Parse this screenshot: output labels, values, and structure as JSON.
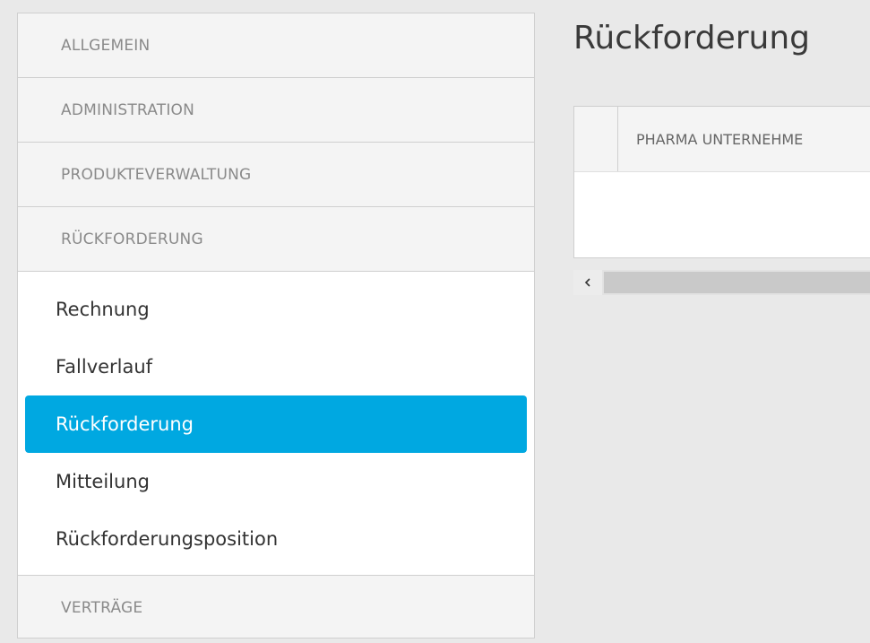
{
  "sidebar": {
    "sections": [
      {
        "label": "ALLGEMEIN"
      },
      {
        "label": "ADMINISTRATION"
      },
      {
        "label": "PRODUKTEVERWALTUNG"
      },
      {
        "label": "RÜCKFORDERUNG"
      }
    ],
    "submenu": [
      {
        "label": "Rechnung"
      },
      {
        "label": "Fallverlauf"
      },
      {
        "label": "Rückforderung"
      },
      {
        "label": "Mitteilung"
      },
      {
        "label": "Rückforderungsposition"
      }
    ],
    "last_section": {
      "label": "VERTRÄGE"
    }
  },
  "main": {
    "title": "Rückforderung",
    "grid": {
      "columns": [
        "PHARMA UNTERNEHME"
      ]
    },
    "scrollbar": {
      "left_arrow_icon": "chevron-left-icon"
    }
  },
  "colors": {
    "accent": "#00a8e1",
    "background": "#e9e9e9"
  }
}
